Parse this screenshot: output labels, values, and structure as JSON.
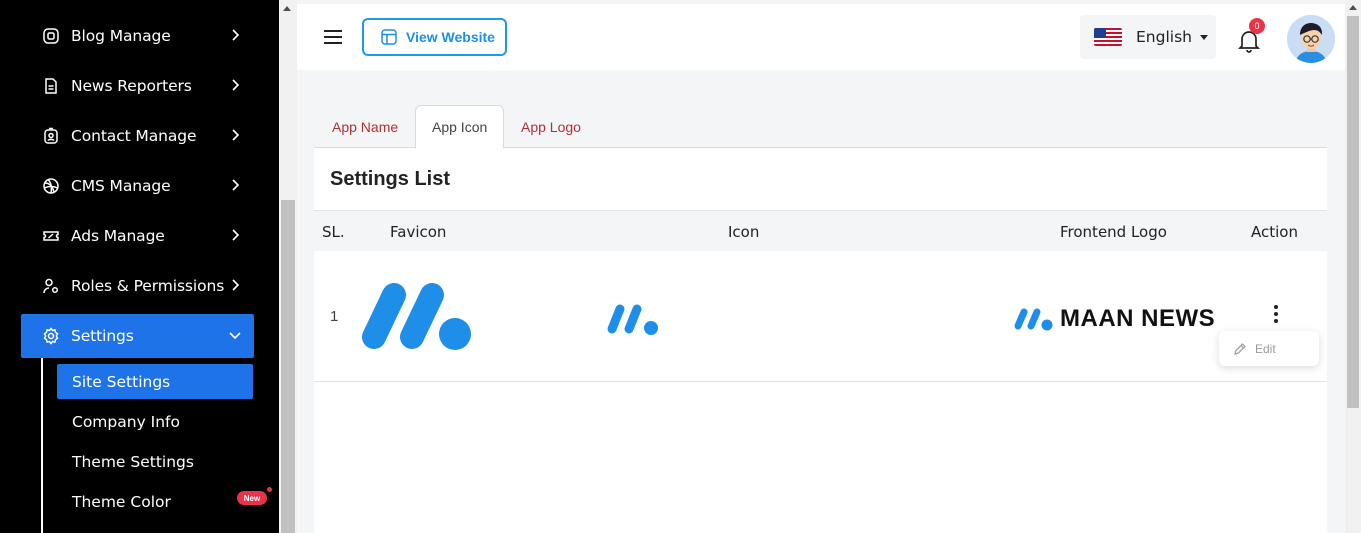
{
  "sidebar": {
    "items": [
      {
        "label": "Blog Manage",
        "icon": "blog-icon"
      },
      {
        "label": "News Reporters",
        "icon": "document-icon"
      },
      {
        "label": "Contact Manage",
        "icon": "contact-icon"
      },
      {
        "label": "CMS Manage",
        "icon": "basketball-icon"
      },
      {
        "label": "Ads Manage",
        "icon": "ticket-icon"
      },
      {
        "label": "Roles & Permissions",
        "icon": "user-settings-icon"
      },
      {
        "label": "Settings",
        "icon": "gear-icon"
      }
    ],
    "subitems": [
      {
        "label": "Site Settings"
      },
      {
        "label": "Company Info"
      },
      {
        "label": "Theme Settings"
      },
      {
        "label": "Theme Color"
      }
    ],
    "new_badge": "New"
  },
  "header": {
    "view_website_label": "View Website",
    "language": "English",
    "notification_count": "0"
  },
  "tabs": [
    {
      "label": "App Name"
    },
    {
      "label": "App Icon"
    },
    {
      "label": "App Logo"
    }
  ],
  "card": {
    "title": "Settings List",
    "columns": {
      "sl": "SL.",
      "favicon": "Favicon",
      "icon": "Icon",
      "frontend_logo": "Frontend Logo",
      "action": "Action"
    },
    "rows": [
      {
        "sl": "1",
        "logo_text": "MAAN NEWS"
      }
    ],
    "menu": {
      "edit_label": "Edit"
    }
  },
  "colors": {
    "primary": "#1e73e8",
    "brand_blue": "#1e8ee8",
    "badge_red": "#e8334a",
    "tab_red": "#b03030"
  }
}
